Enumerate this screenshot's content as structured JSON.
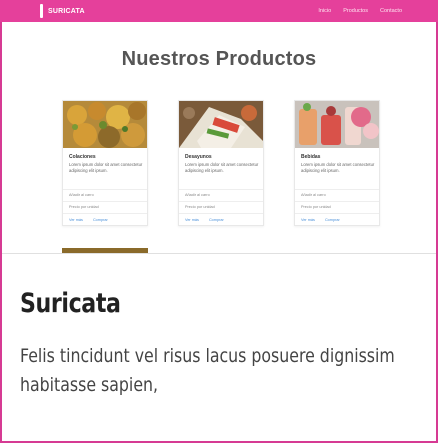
{
  "navbar": {
    "brand": "SURICATA",
    "links": [
      "Inicio",
      "Productos",
      "Contacto"
    ]
  },
  "products": {
    "title": "Nuestros Productos",
    "cards": [
      {
        "name": "Colaciones",
        "description": "Lorem ipsum dolor sit amet consectetur adipiscing elit ipsum.",
        "meta1": "Añadir al carro",
        "meta2": "Precio por unidad",
        "link1": "Ver más",
        "link2": "Comprar"
      },
      {
        "name": "Desayunos",
        "description": "Lorem ipsum dolor sit amet consectetur adipiscing elit ipsum.",
        "meta1": "Añadir al carro",
        "meta2": "Precio por unidad",
        "link1": "Ver más",
        "link2": "Comprar"
      },
      {
        "name": "Bebidas",
        "description": "Lorem ipsum dolor sit amet consectetur adipiscing elit ipsum.",
        "meta1": "Añadir al carro",
        "meta2": "Precio por unidad",
        "link1": "Ver más",
        "link2": "Comprar"
      }
    ]
  },
  "panel": {
    "title": "Suricata",
    "text": "Felis tincidunt vel risus lacus posuere dignissim habitasse sapien,"
  },
  "colors": {
    "brand": "#e5409b",
    "frame": "#d63a93",
    "link": "#4a90d9"
  }
}
